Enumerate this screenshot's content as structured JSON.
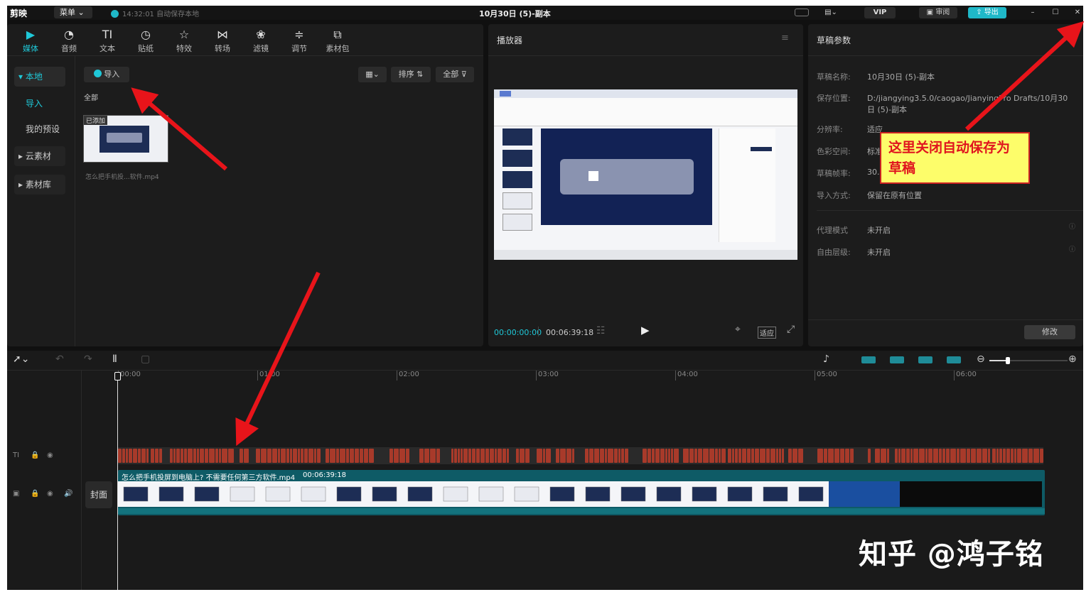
{
  "app": {
    "logo": "剪映",
    "menu": "菜单",
    "autosave": "14:32:01 自动保存本地",
    "title": "10月30日 (5)-副本"
  },
  "titlebar": {
    "vip": "VIP",
    "review": "审阅",
    "export": "导出"
  },
  "media_tools": [
    {
      "label": "媒体",
      "glyph": "▶"
    },
    {
      "label": "音频",
      "glyph": "◔"
    },
    {
      "label": "文本",
      "glyph": "TI"
    },
    {
      "label": "贴纸",
      "glyph": "◷"
    },
    {
      "label": "特效",
      "glyph": "☆"
    },
    {
      "label": "转场",
      "glyph": "⋈"
    },
    {
      "label": "滤镜",
      "glyph": "❀"
    },
    {
      "label": "调节",
      "glyph": "≑"
    },
    {
      "label": "素材包",
      "glyph": "⧉"
    }
  ],
  "sidebar": {
    "local": "▾ 本地",
    "import": "导入",
    "presets": "我的预设",
    "cloud": "▸ 云素材",
    "library": "▸ 素材库"
  },
  "media": {
    "import_btn": "导入",
    "sort": "排序",
    "all": "全部",
    "filter_all": "全部",
    "added_badge": "已添加",
    "clip_name": "怎么把手机投...软件.mp4"
  },
  "player": {
    "title": "播放器",
    "current_time": "00:00:00:00",
    "total_time": "00:06:39:18",
    "fit": "适应"
  },
  "draft": {
    "title": "草稿参数",
    "rows": [
      {
        "label": "草稿名称:",
        "value": "10月30日 (5)-副本"
      },
      {
        "label": "保存位置:",
        "value": "D:/jiangying3.5.0/caogao/JianyingPro Drafts/10月30日 (5)-副本"
      },
      {
        "label": "分辨率:",
        "value": "适应"
      },
      {
        "label": "色彩空间:",
        "value": "标准"
      },
      {
        "label": "草稿帧率:",
        "value": "30.00"
      },
      {
        "label": "导入方式:",
        "value": "保留在原有位置"
      },
      {
        "label": "代理模式",
        "value": "未开启"
      },
      {
        "label": "自由层级:",
        "value": "未开启"
      }
    ],
    "modify_btn": "修改"
  },
  "timeline": {
    "ruler": [
      "00:00",
      "01:00",
      "02:00",
      "03:00",
      "04:00",
      "05:00",
      "06:00"
    ],
    "clip_name": "怎么把手机投屏到电脑上? 不需要任何第三方软件.mp4",
    "clip_duration": "00:06:39:18",
    "cover": "封面"
  },
  "annotation": {
    "callout": "这里关闭自动保存为草稿"
  },
  "watermark": "知乎 @鸿子铭",
  "colors": {
    "accent": "#1fc8d8",
    "arrow": "#e8141a",
    "callout_bg": "#fdfd6a",
    "text_track": "#a83a2a",
    "video_track": "#0e5b66"
  }
}
